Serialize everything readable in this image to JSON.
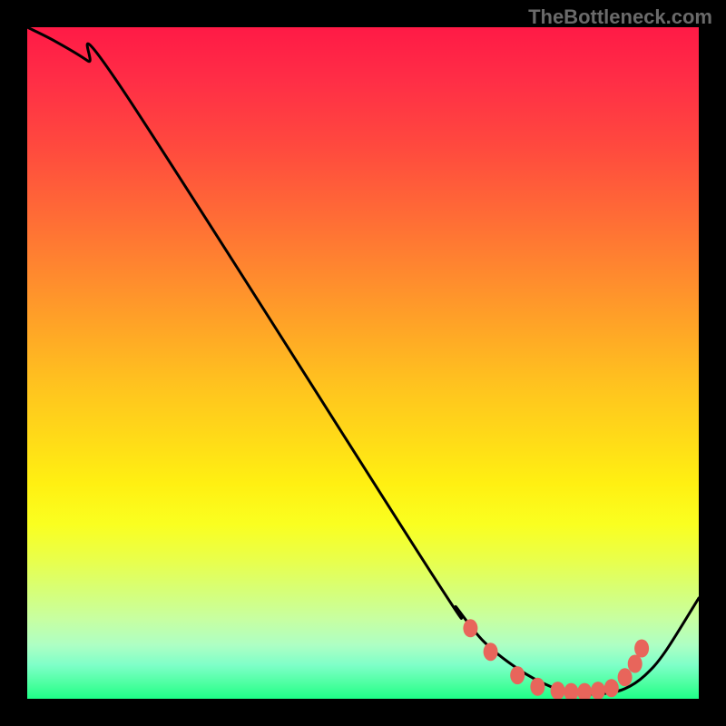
{
  "watermark": "TheBottleneck.com",
  "chart_data": {
    "type": "line",
    "title": "",
    "xlabel": "",
    "ylabel": "",
    "xlim": [
      0,
      100
    ],
    "ylim": [
      0,
      100
    ],
    "series": [
      {
        "name": "curve",
        "x": [
          0,
          4,
          9,
          14,
          60,
          64,
          68,
          73,
          78,
          82,
          86,
          89,
          92,
          95,
          100
        ],
        "y": [
          100,
          98,
          95,
          91,
          19,
          13.5,
          8.5,
          4.5,
          1.8,
          0.8,
          0.8,
          1.5,
          3.5,
          7,
          15
        ]
      }
    ],
    "markers": {
      "name": "highlight-dots",
      "color": "#e8655b",
      "points": [
        {
          "x": 66,
          "y": 10.5
        },
        {
          "x": 69,
          "y": 7
        },
        {
          "x": 73,
          "y": 3.5
        },
        {
          "x": 76,
          "y": 1.8
        },
        {
          "x": 79,
          "y": 1.2
        },
        {
          "x": 81,
          "y": 1.0
        },
        {
          "x": 83,
          "y": 1.0
        },
        {
          "x": 85,
          "y": 1.2
        },
        {
          "x": 87,
          "y": 1.6
        },
        {
          "x": 89,
          "y": 3.2
        },
        {
          "x": 90.5,
          "y": 5.2
        },
        {
          "x": 91.5,
          "y": 7.5
        }
      ]
    }
  }
}
